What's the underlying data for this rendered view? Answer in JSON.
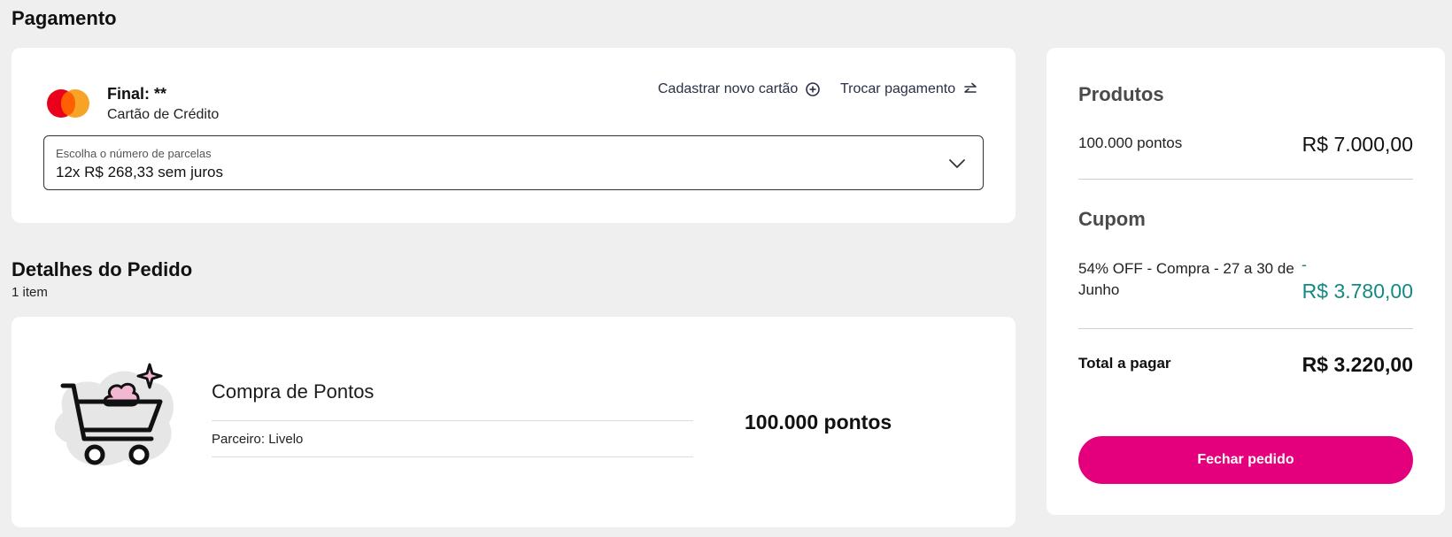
{
  "payment": {
    "title": "Pagamento",
    "card_final": "Final: **",
    "card_type": "Cartão de Crédito",
    "link_new_card": "Cadastrar novo cartão",
    "link_switch_payment": "Trocar pagamento",
    "installments_label": "Escolha o número de parcelas",
    "installments_value": "12x R$ 268,33 sem juros"
  },
  "details": {
    "title": "Detalhes do Pedido",
    "count": "1 item",
    "product_name": "Compra de Pontos",
    "partner": "Parceiro: Livelo",
    "points": "100.000 pontos"
  },
  "summary": {
    "products_heading": "Produtos",
    "products_item": "100.000 pontos",
    "products_price": "R$ 7.000,00",
    "coupon_heading": "Cupom",
    "coupon_item": "54% OFF - Compra - 27 a 30 de Junho",
    "coupon_dash": "-",
    "coupon_price": "R$ 3.780,00",
    "total_label": "Total a pagar",
    "total_value": "R$ 3.220,00",
    "checkout_label": "Fechar pedido"
  },
  "colors": {
    "accent": "#e4007c",
    "discount": "#138a84",
    "background": "#efefef"
  },
  "icons": [
    "mastercard-logo",
    "plus-circle-icon",
    "swap-arrows-icon",
    "chevron-down-icon",
    "shopping-cart-icon"
  ]
}
